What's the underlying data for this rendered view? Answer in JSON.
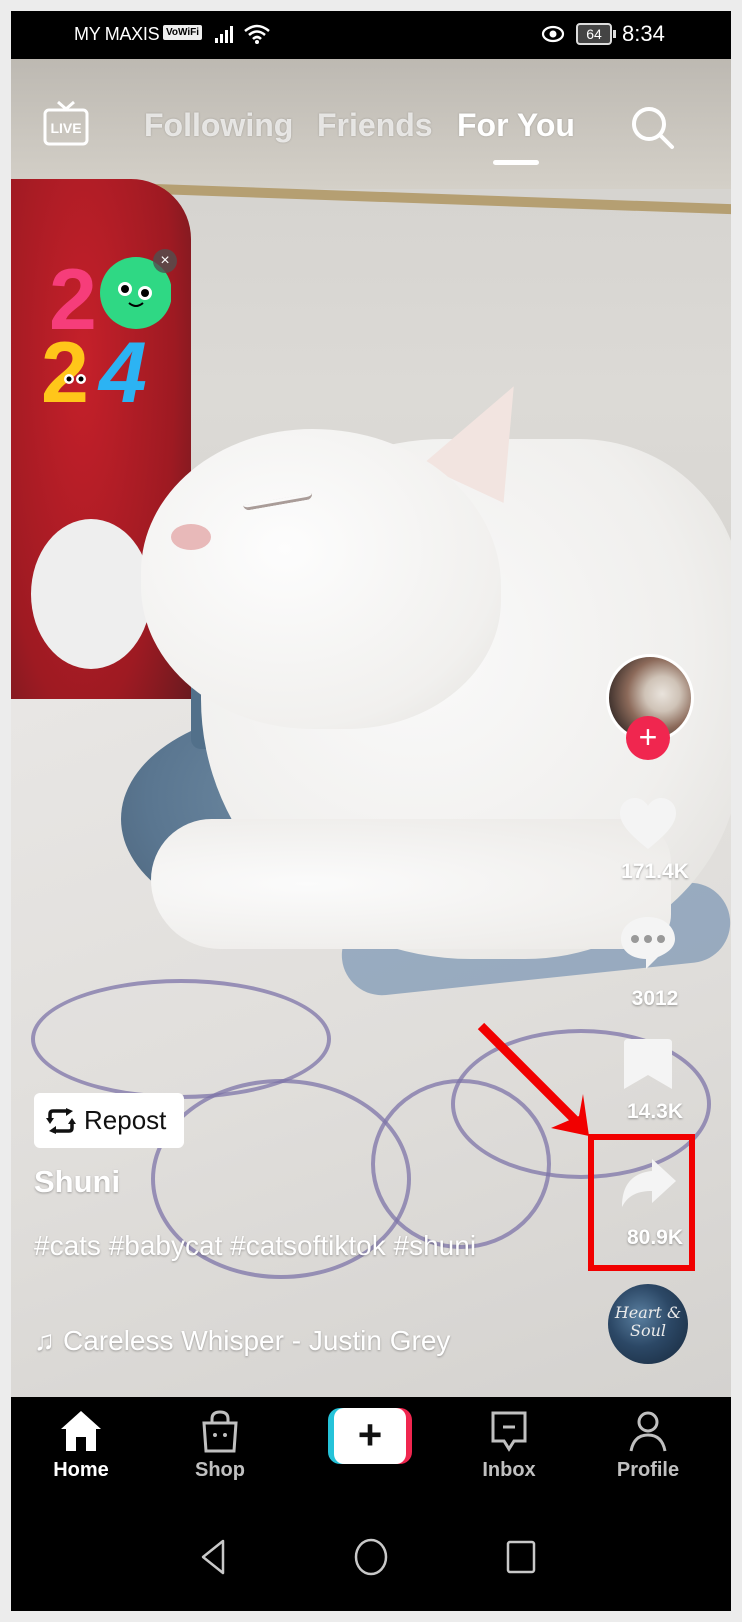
{
  "status_bar": {
    "carrier": "MY MAXIS",
    "vowifi_badge": "VoWiFi",
    "signal_icon": "signal-bars-icon",
    "wifi_icon": "wifi-icon",
    "eye_icon": "eye-comfort-icon",
    "battery_level": "64",
    "time": "8:34"
  },
  "top_nav": {
    "live_label": "LIVE",
    "tabs": [
      {
        "label": "Following",
        "active": false
      },
      {
        "label": "Friends",
        "active": false
      },
      {
        "label": "For You",
        "active": true
      }
    ],
    "search_icon": "search-icon"
  },
  "sticker": {
    "text": "2024",
    "close_label": "×"
  },
  "creator": {
    "avatar_icon": "creator-avatar",
    "follow_label": "+"
  },
  "actions": {
    "likes": "171.4K",
    "comments": "3012",
    "saves": "14.3K",
    "shares": "80.9K"
  },
  "music_disc": {
    "text": "Heart & Soul"
  },
  "post": {
    "repost_label": "Repost",
    "username": "Shuni",
    "caption": "#cats #babycat #catsoftiktok #shuni",
    "music_note": "♫",
    "music": "Careless Whisper - Justin Grey"
  },
  "annotation": {
    "color": "#f10000"
  },
  "bottom_nav": {
    "items": [
      {
        "label": "Home",
        "active": true
      },
      {
        "label": "Shop",
        "active": false
      },
      {
        "label": "",
        "active": false
      },
      {
        "label": "Inbox",
        "active": false
      },
      {
        "label": "Profile",
        "active": false
      }
    ],
    "create_label": "+"
  },
  "colors": {
    "brand_pink": "#f0264f",
    "brand_cyan": "#25c3d9"
  }
}
